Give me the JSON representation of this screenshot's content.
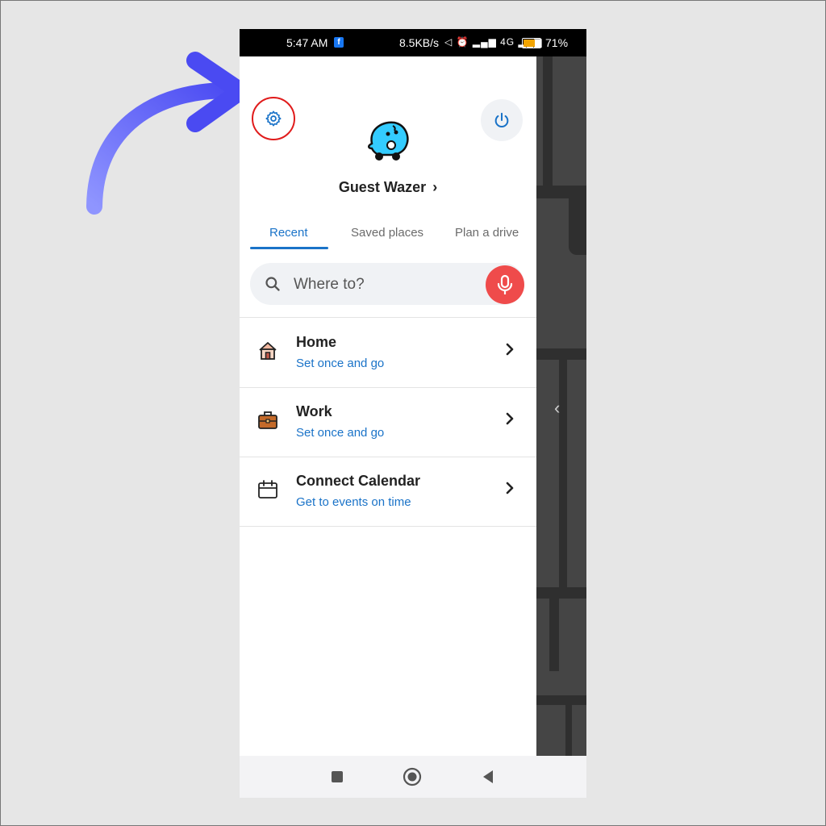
{
  "status_bar": {
    "time": "5:47 AM",
    "fb_badge": "f",
    "speed": "8.5KB/s",
    "signal_icons": "◁ ⏰ ▂▄▆ 4G ▂▄▆",
    "battery_percent": "71%"
  },
  "header": {
    "settings_icon": "gear-icon",
    "power_icon": "power-icon",
    "avatar_icon": "waze-mascot-icon",
    "user_name": "Guest Wazer",
    "user_chevron": "›"
  },
  "tabs": [
    {
      "label": "Recent",
      "active": true
    },
    {
      "label": "Saved places",
      "active": false
    },
    {
      "label": "Plan a drive",
      "active": false
    }
  ],
  "search": {
    "placeholder": "Where to?",
    "value": ""
  },
  "rows": [
    {
      "title": "Home",
      "subtitle": "Set once and go",
      "icon": "home-icon"
    },
    {
      "title": "Work",
      "subtitle": "Set once and go",
      "icon": "briefcase-icon"
    },
    {
      "title": "Connect Calendar",
      "subtitle": "Get to events on time",
      "icon": "calendar-icon"
    }
  ],
  "map": {
    "collapse_chevron": "‹"
  },
  "colors": {
    "accent": "#1a73c8",
    "mic": "#ef4b4b",
    "highlight_ring": "#e01b1b",
    "pointer_arrow": "#6f6ff8",
    "waze_blue": "#33ccff"
  }
}
